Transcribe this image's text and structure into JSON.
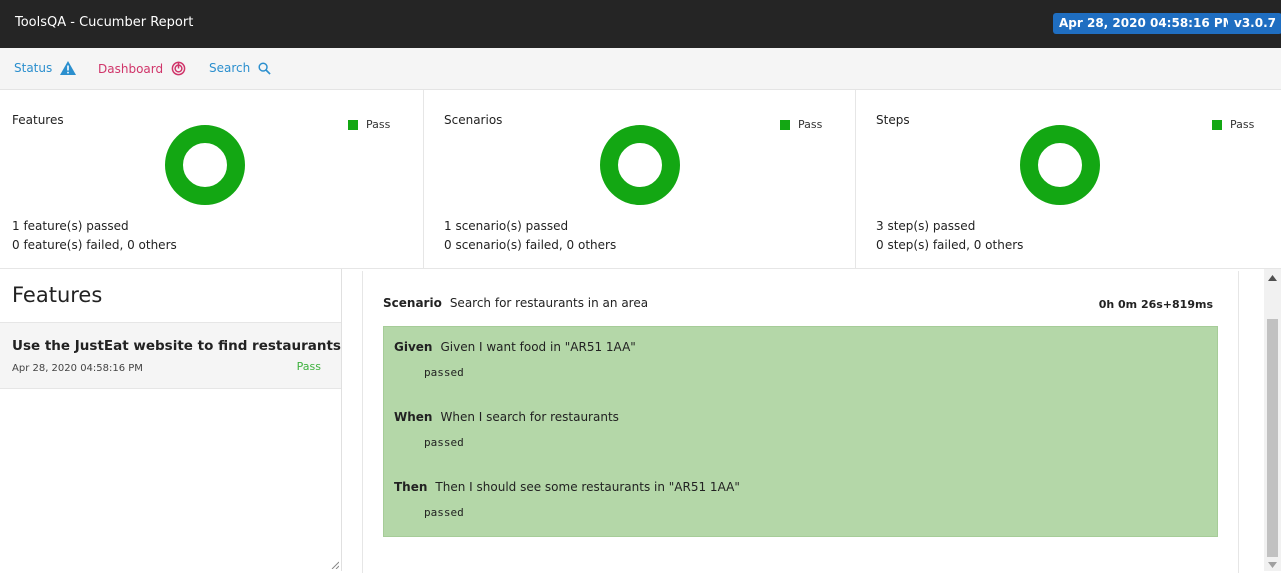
{
  "header": {
    "title": "ToolsQA - Cucumber Report",
    "timestamp": "Apr 28, 2020 04:58:16 PM",
    "version": "v3.0.7"
  },
  "nav": {
    "status": "Status",
    "dashboard": "Dashboard",
    "search": "Search"
  },
  "summary": {
    "features": {
      "title": "Features",
      "legend": "Pass",
      "passed": "1 feature(s) passed",
      "failed": "0 feature(s) failed, 0 others",
      "pass_fraction": 1.0
    },
    "scenarios": {
      "title": "Scenarios",
      "legend": "Pass",
      "passed": "1 scenario(s) passed",
      "failed": "0 scenario(s) failed, 0 others",
      "pass_fraction": 1.0
    },
    "steps": {
      "title": "Steps",
      "legend": "Pass",
      "passed": "3 step(s) passed",
      "failed": "0 step(s) failed, 0 others",
      "pass_fraction": 1.0
    }
  },
  "colors": {
    "pass": "#13a713",
    "steps_background": "#b4d7a8",
    "accent": "#1f6ec1"
  },
  "left": {
    "heading": "Features",
    "feature": {
      "name": "Use the JustEat website to find restaurants",
      "date": "Apr 28, 2020 04:58:16 PM",
      "status": "Pass"
    }
  },
  "scenario": {
    "keyword": "Scenario",
    "name": "Search for restaurants in an area",
    "duration": "0h 0m 26s+819ms",
    "steps": [
      {
        "keyword": "Given",
        "text": "Given I want food in \"AR51 1AA\"",
        "result": "passed"
      },
      {
        "keyword": "When",
        "text": "When I search for restaurants",
        "result": "passed"
      },
      {
        "keyword": "Then",
        "text": "Then I should see some restaurants in \"AR51 1AA\"",
        "result": "passed"
      }
    ]
  }
}
